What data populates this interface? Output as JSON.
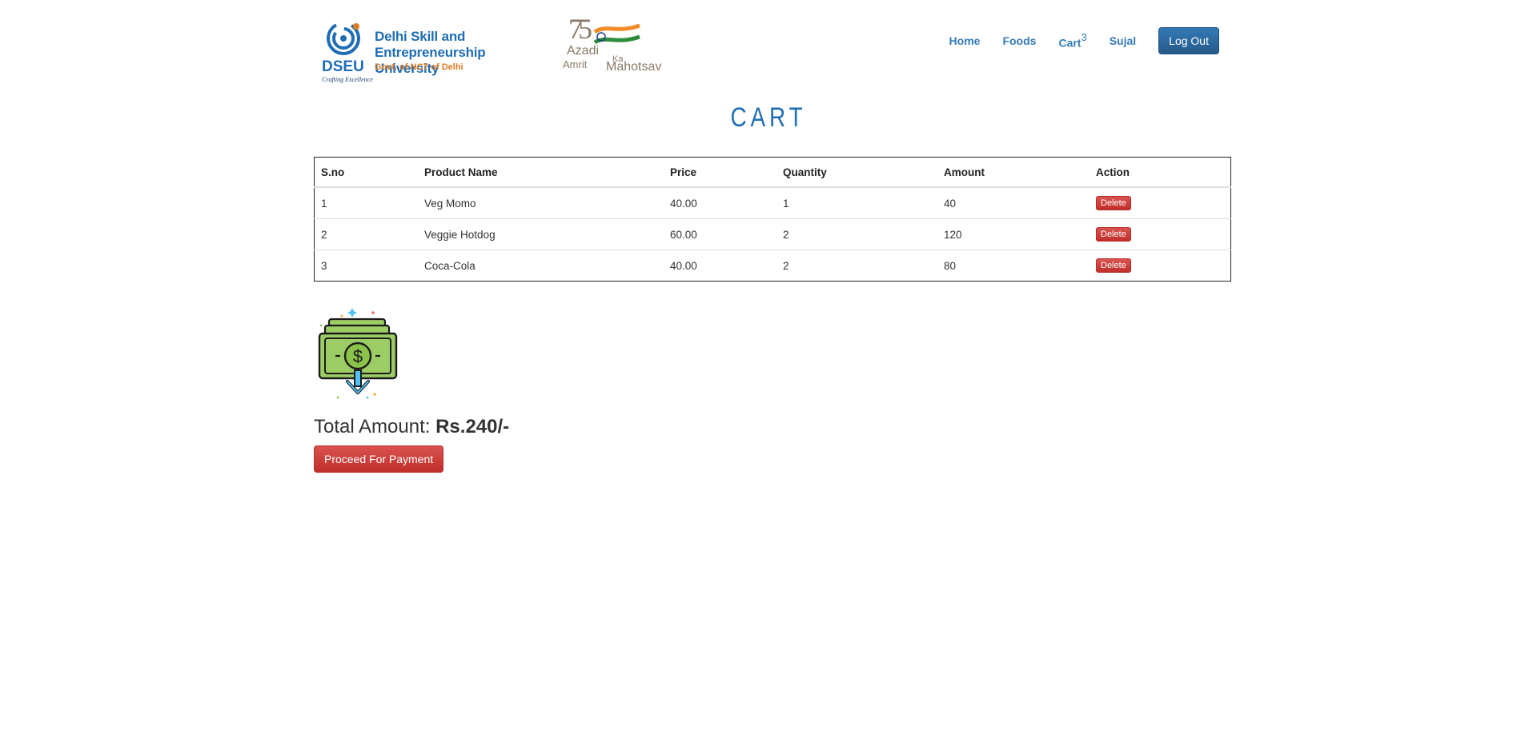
{
  "header": {
    "dseu_abbr": "DSEU",
    "dseu_tagline": "Crafting Excellence",
    "dseu_name_line1": "Delhi Skill and",
    "dseu_name_line2": "Entrepreneurship University",
    "dseu_govt": "Govt. of NCT of Delhi",
    "azadi_75": "75",
    "azadi_word1": "Azadi",
    "azadi_word2": "Ka",
    "azadi_word3": "Amrit",
    "azadi_word4": "Mahotsav"
  },
  "nav": {
    "home": "Home",
    "foods": "Foods",
    "cart": "Cart",
    "cart_count": "3",
    "user": "Sujal",
    "logout": "Log Out"
  },
  "page": {
    "title": "CART"
  },
  "table": {
    "headers": {
      "sno": "S.no",
      "product": "Product Name",
      "price": "Price",
      "quantity": "Quantity",
      "amount": "Amount",
      "action": "Action"
    },
    "rows": [
      {
        "sno": "1",
        "product": "Veg Momo",
        "price": "40.00",
        "quantity": "1",
        "amount": "40",
        "action": "Delete"
      },
      {
        "sno": "2",
        "product": "Veggie Hotdog",
        "price": "60.00",
        "quantity": "2",
        "amount": "120",
        "action": "Delete"
      },
      {
        "sno": "3",
        "product": "Coca-Cola",
        "price": "40.00",
        "quantity": "2",
        "amount": "80",
        "action": "Delete"
      }
    ]
  },
  "summary": {
    "total_label": "Total Amount:",
    "total_value": "Rs.240/-",
    "pay_button": "Proceed For Payment",
    "icon": "money-download-icon"
  },
  "colors": {
    "brand_blue": "#1f6db5",
    "link_blue": "#337ab7",
    "danger_red": "#d9534f",
    "dseu_orange": "#e07b1f"
  }
}
